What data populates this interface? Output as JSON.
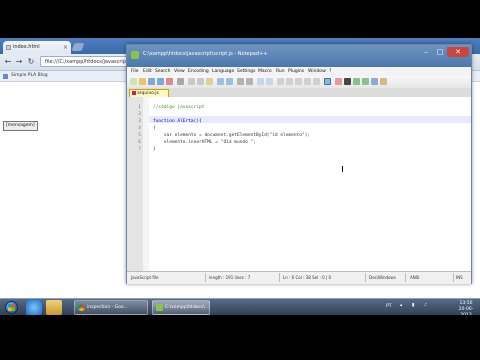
{
  "colors": {
    "accent": "#4c76ac",
    "taskbar": "#2f3e52",
    "close": "#c9463d"
  },
  "chrome": {
    "tab_title": "index.html",
    "address": "file:///C:/xampp/htdocs/javascript/index.html",
    "bookmark": "Simple PLA Blog",
    "page_button": "[mensagem]"
  },
  "npp": {
    "title": "C:\\xampp\\htdocs\\javascript\\script.js - Notepad++",
    "menu": [
      "File",
      "Edit",
      "Search",
      "View",
      "Encoding",
      "Language",
      "Settings",
      "Macro",
      "Run",
      "Plugins",
      "Window",
      "?"
    ],
    "tab_label": "arquivo.js",
    "code_lines": [
      {
        "num": "1",
        "text": "//código javascript",
        "cls": "c-comment"
      },
      {
        "num": "2",
        "text": "",
        "cls": ""
      },
      {
        "num": "3",
        "text": "function AlErta(){",
        "cls": "c-key"
      },
      {
        "num": "4",
        "text": "{",
        "cls": ""
      },
      {
        "num": "5",
        "text": "    var elemento = document.getElementById(\"id elemento\");",
        "cls": ""
      },
      {
        "num": "6",
        "text": "    elemento.innerHTML = \"Olá mundo \";",
        "cls": ""
      },
      {
        "num": "7",
        "text": "}",
        "cls": ""
      }
    ],
    "status": {
      "type": "JavaScript file",
      "length": "length : 191    lines : 7",
      "pos": "Ln : 6    Col : 38    Sel : 0 | 0",
      "eol": "Dos\\Windows",
      "enc": "ANSI",
      "mode": "INS"
    }
  },
  "taskbar": {
    "tasks": [
      "inspection - Goo...",
      "C:\\xampp\\htdocs\\..."
    ],
    "tray_lang": "PT",
    "clock_time": "13:50",
    "clock_date": "20-06-2013"
  }
}
